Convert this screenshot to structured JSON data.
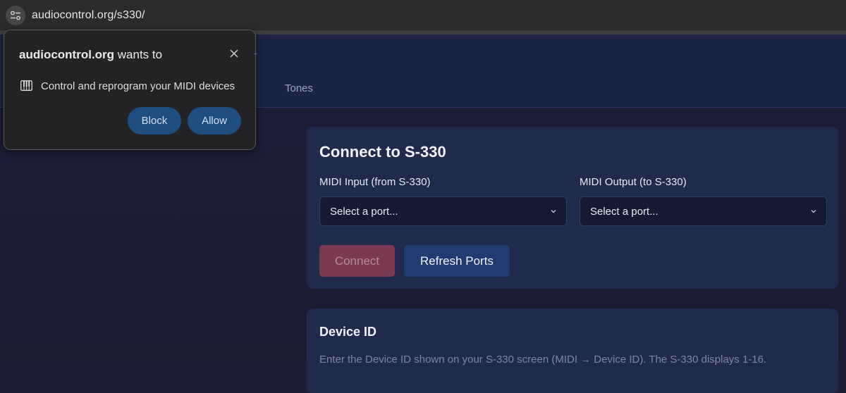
{
  "browser": {
    "url": "audiocontrol.org/s330/",
    "icons": {
      "site_settings": "tune-icon"
    }
  },
  "nav": {
    "tabs": [
      {
        "label": "Tones"
      }
    ]
  },
  "connect_card": {
    "title": "Connect to S-330",
    "midi_input_label": "MIDI Input (from S-330)",
    "midi_input_value": "Select a port...",
    "midi_output_label": "MIDI Output (to S-330)",
    "midi_output_value": "Select a port...",
    "connect_label": "Connect",
    "refresh_label": "Refresh Ports"
  },
  "device_card": {
    "title": "Device ID",
    "description": "Enter the Device ID shown on your S-330 screen (MIDI → Device ID). The S-330 displays 1-16."
  },
  "permission_popup": {
    "site": "audiocontrol.org",
    "wants_to": " wants to",
    "permission_text": "Control and reprogram your MIDI devices",
    "block_label": "Block",
    "allow_label": "Allow",
    "icons": {
      "close": "close-icon",
      "permission": "midi-piano-icon"
    }
  },
  "colors": {
    "page_bg": "#1b1d33",
    "card_bg": "#1f2a4d",
    "connect_disabled": "#7c3a52",
    "refresh_bg": "#213a72",
    "popup_button": "#1e4d80"
  }
}
